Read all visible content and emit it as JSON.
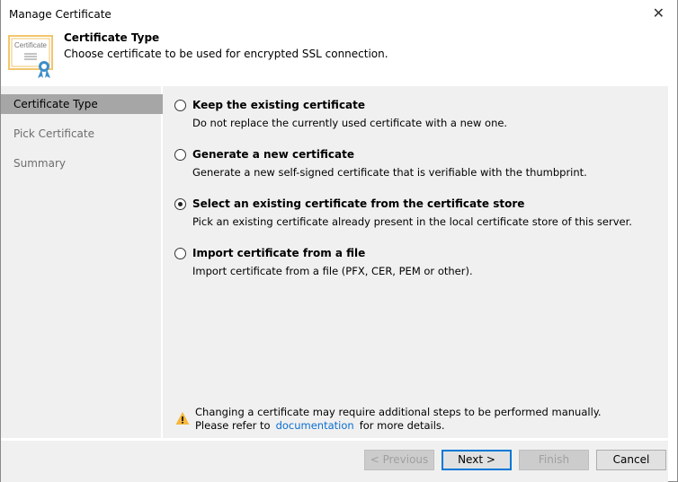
{
  "window": {
    "title": "Manage Certificate"
  },
  "header": {
    "title": "Certificate Type",
    "subtitle": "Choose certificate to be used for encrypted SSL connection.",
    "icon_text": "Certificate"
  },
  "sidebar": {
    "items": [
      {
        "label": "Certificate Type",
        "selected": true
      },
      {
        "label": "Pick Certificate"
      },
      {
        "label": "Summary"
      }
    ]
  },
  "options": [
    {
      "label": "Keep the existing certificate",
      "desc": "Do not replace the currently used certificate with a new one.",
      "checked": false
    },
    {
      "label": "Generate a new certificate",
      "desc": "Generate a new self-signed certificate that is verifiable with the thumbprint.",
      "checked": false
    },
    {
      "label": "Select an existing certificate from the certificate store",
      "desc": "Pick an existing certificate already present in the local certificate store of this server.",
      "checked": true
    },
    {
      "label": "Import certificate from a file",
      "desc": "Import certificate from a file (PFX, CER, PEM or other).",
      "checked": false
    }
  ],
  "warning": {
    "line1": "Changing a certificate may require additional steps to be performed manually.",
    "prefix": "Please refer to",
    "link": "documentation",
    "suffix": "for more details."
  },
  "buttons": {
    "previous": "< Previous",
    "next": "Next >",
    "finish": "Finish",
    "cancel": "Cancel"
  }
}
